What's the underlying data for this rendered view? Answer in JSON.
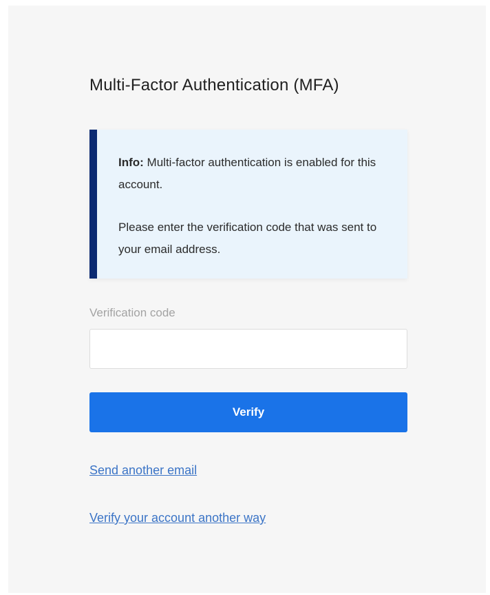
{
  "page": {
    "title": "Multi-Factor Authentication (MFA)"
  },
  "info": {
    "label": "Info:",
    "line1": " Multi-factor authentication is enabled for this account.",
    "line2": "Please enter the verification code that was sent to your email address.",
    "bar_color": "#0b2a72",
    "background_color": "#eaf4fc"
  },
  "form": {
    "code_label": "Verification code",
    "code_value": "",
    "code_placeholder": "",
    "verify_label": "Verify",
    "button_color": "#1a73e8"
  },
  "links": {
    "send_another": "Send another email",
    "another_way": "Verify your account another way",
    "link_color": "#3b74c6"
  }
}
